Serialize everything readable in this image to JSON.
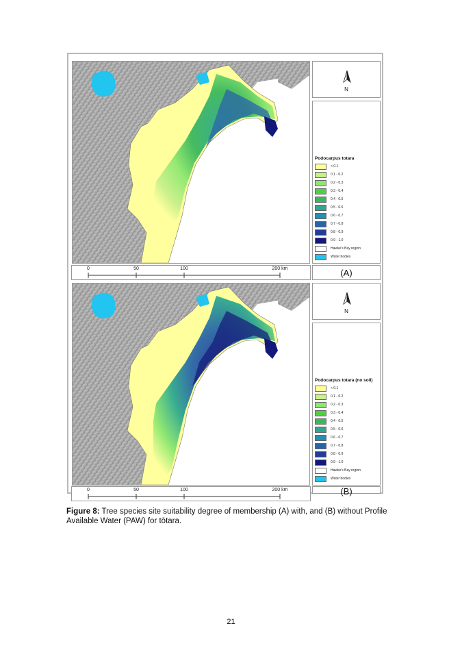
{
  "panels": [
    {
      "legend_title": "Podocarpus totara",
      "panel_label": "(A)",
      "north_label": "N",
      "scale_labels": [
        "0",
        "50",
        "100",
        "200 km"
      ]
    },
    {
      "legend_title": "Podocarpus totara (no soil)",
      "panel_label": "(B)",
      "north_label": "N",
      "scale_labels": [
        "0",
        "50",
        "100",
        "200 km"
      ]
    }
  ],
  "legend_classes": [
    {
      "label": "< 0.1",
      "color": "#ffff9e"
    },
    {
      "label": "0.1 - 0.2",
      "color": "#c8f08c"
    },
    {
      "label": "0.2 - 0.3",
      "color": "#8ee870"
    },
    {
      "label": "0.3 - 0.4",
      "color": "#4cd23c"
    },
    {
      "label": "0.4 - 0.5",
      "color": "#3cb85c"
    },
    {
      "label": "0.5 - 0.6",
      "color": "#2ea890"
    },
    {
      "label": "0.6 - 0.7",
      "color": "#2690b0"
    },
    {
      "label": "0.7 - 0.8",
      "color": "#2a64a8"
    },
    {
      "label": "0.8 - 0.9",
      "color": "#243c98"
    },
    {
      "label": "0.9 - 1.0",
      "color": "#141878"
    },
    {
      "label": "Hawke's Bay region",
      "color": "#ffffff"
    },
    {
      "label": "Water bodies",
      "color": "#22c4f0"
    }
  ],
  "caption": {
    "lead": "Figure 8:",
    "text": " Tree species site suitability degree of membership (A) with, and (B) without Profile Available Water (PAW) for tōtara."
  },
  "page_number": "21"
}
